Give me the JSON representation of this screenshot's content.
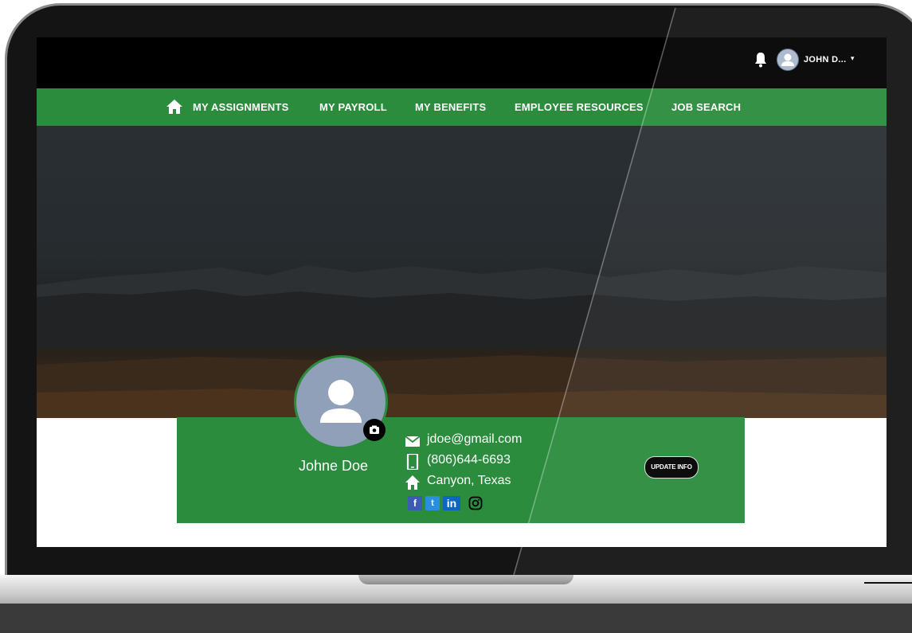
{
  "header": {
    "user_name": "JOHN D...",
    "caret": "▾"
  },
  "nav": {
    "items": [
      {
        "label": "MY ASSIGNMENTS"
      },
      {
        "label": "MY PAYROLL"
      },
      {
        "label": "MY BENEFITS"
      },
      {
        "label": "EMPLOYEE RESOURCES"
      },
      {
        "label": "JOB SEARCH"
      }
    ]
  },
  "profile": {
    "name": "Johne Doe",
    "email": "jdoe@gmail.com",
    "phone": "(806)644-6693",
    "location": "Canyon, Texas",
    "socials": [
      {
        "icon": "facebook-icon",
        "glyph": "f"
      },
      {
        "icon": "twitter-icon",
        "glyph": "t"
      },
      {
        "icon": "linkedin-icon",
        "glyph": "in"
      },
      {
        "icon": "instagram-icon",
        "glyph": ""
      }
    ],
    "update_label": "UPDATE INFO"
  },
  "colors": {
    "brand_green": "#2a8c3c",
    "topbar": "#000000"
  }
}
